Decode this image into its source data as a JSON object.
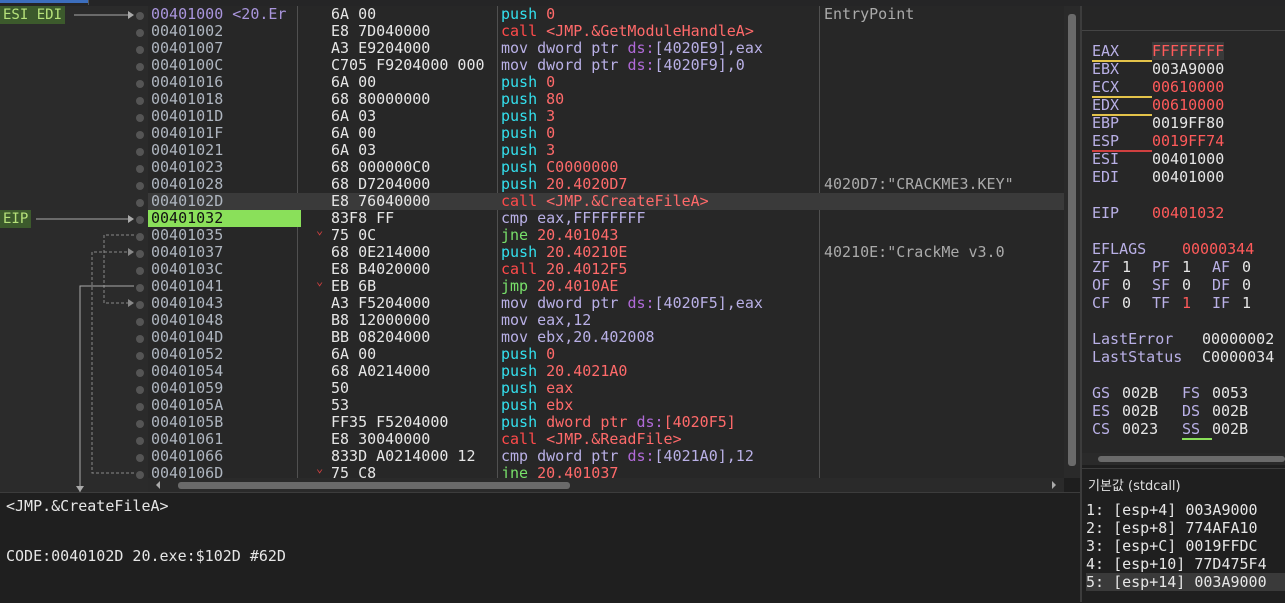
{
  "gutter": {
    "labels": [
      {
        "text": "ESI EDI",
        "row": 0
      },
      {
        "text": "EIP",
        "row": 12
      }
    ]
  },
  "disasm": {
    "rows": [
      {
        "addr": "00401000 <20.Er",
        "bytes": "6A 00",
        "mn": "push",
        "op": "0",
        "cmt": "EntryPoint",
        "style": "push",
        "ep": true
      },
      {
        "addr": "00401002",
        "bytes": "E8 7D040000",
        "mn": "call",
        "op": "<JMP.&GetModuleHandleA>",
        "cmt": "",
        "style": "call"
      },
      {
        "addr": "00401007",
        "bytes": "A3 E9204000",
        "mn": "mov",
        "op": "dword ptr ds:[4020E9],eax",
        "cmt": "",
        "style": "mov"
      },
      {
        "addr": "0040100C",
        "bytes": "C705 F9204000 000",
        "mn": "mov",
        "op": "dword ptr ds:[4020F9],0",
        "cmt": "",
        "style": "mov"
      },
      {
        "addr": "00401016",
        "bytes": "6A 00",
        "mn": "push",
        "op": "0",
        "cmt": "",
        "style": "push"
      },
      {
        "addr": "00401018",
        "bytes": "68 80000000",
        "mn": "push",
        "op": "80",
        "cmt": "",
        "style": "push"
      },
      {
        "addr": "0040101D",
        "bytes": "6A 03",
        "mn": "push",
        "op": "3",
        "cmt": "",
        "style": "push"
      },
      {
        "addr": "0040101F",
        "bytes": "6A 00",
        "mn": "push",
        "op": "0",
        "cmt": "",
        "style": "push"
      },
      {
        "addr": "00401021",
        "bytes": "6A 03",
        "mn": "push",
        "op": "3",
        "cmt": "",
        "style": "push"
      },
      {
        "addr": "00401023",
        "bytes": "68 000000C0",
        "mn": "push",
        "op": "C0000000",
        "cmt": "",
        "style": "push"
      },
      {
        "addr": "00401028",
        "bytes": "68 D7204000",
        "mn": "push",
        "op": "20.4020D7",
        "cmt": "4020D7:\"CRACKME3.KEY\"",
        "style": "push"
      },
      {
        "addr": "0040102D",
        "bytes": "E8 76040000",
        "mn": "call",
        "op": "<JMP.&CreateFileA>",
        "cmt": "",
        "style": "call",
        "sel": true
      },
      {
        "addr": "00401032",
        "bytes": "83F8 FF",
        "mn": "cmp",
        "op": "eax,FFFFFFFF",
        "cmt": "",
        "style": "cmp",
        "eip": true
      },
      {
        "addr": "00401035",
        "bytes": "75 0C",
        "mn": "jne",
        "op": "20.401043",
        "cmt": "",
        "style": "jne"
      },
      {
        "addr": "00401037",
        "bytes": "68 0E214000",
        "mn": "push",
        "op": "20.40210E",
        "cmt": "40210E:\"CrackMe v3.0",
        "style": "push"
      },
      {
        "addr": "0040103C",
        "bytes": "E8 B4020000",
        "mn": "call",
        "op": "20.4012F5",
        "cmt": "",
        "style": "call"
      },
      {
        "addr": "00401041",
        "bytes": "EB 6B",
        "mn": "jmp",
        "op": "20.4010AE",
        "cmt": "",
        "style": "jmp"
      },
      {
        "addr": "00401043",
        "bytes": "A3 F5204000",
        "mn": "mov",
        "op": "dword ptr ds:[4020F5],eax",
        "cmt": "",
        "style": "mov"
      },
      {
        "addr": "00401048",
        "bytes": "B8 12000000",
        "mn": "mov",
        "op": "eax,12",
        "cmt": "",
        "style": "mov"
      },
      {
        "addr": "0040104D",
        "bytes": "BB 08204000",
        "mn": "mov",
        "op": "ebx,20.402008",
        "cmt": "",
        "style": "mov"
      },
      {
        "addr": "00401052",
        "bytes": "6A 00",
        "mn": "push",
        "op": "0",
        "cmt": "",
        "style": "push"
      },
      {
        "addr": "00401054",
        "bytes": "68 A0214000",
        "mn": "push",
        "op": "20.4021A0",
        "cmt": "",
        "style": "push"
      },
      {
        "addr": "00401059",
        "bytes": "50",
        "mn": "push",
        "op": "eax",
        "cmt": "",
        "style": "push"
      },
      {
        "addr": "0040105A",
        "bytes": "53",
        "mn": "push",
        "op": "ebx",
        "cmt": "",
        "style": "push"
      },
      {
        "addr": "0040105B",
        "bytes": "FF35 F5204000",
        "mn": "push",
        "op": "dword ptr ds:[4020F5]",
        "cmt": "",
        "style": "push"
      },
      {
        "addr": "00401061",
        "bytes": "E8 30040000",
        "mn": "call",
        "op": "<JMP.&ReadFile>",
        "cmt": "",
        "style": "call"
      },
      {
        "addr": "00401066",
        "bytes": "833D A0214000 12",
        "mn": "cmp",
        "op": "dword ptr ds:[4021A0],12",
        "cmt": "",
        "style": "cmp"
      },
      {
        "addr": "0040106D",
        "bytes": "75 C8",
        "mn": "jne",
        "op": "20.401037",
        "cmt": "",
        "style": "jne"
      }
    ]
  },
  "registers": [
    {
      "name": "EAX",
      "value": "FFFFFFFF",
      "red": true,
      "ul": "#e4c34a",
      "hl": true
    },
    {
      "name": "EBX",
      "value": "003A9000",
      "red": false
    },
    {
      "name": "ECX",
      "value": "00610000",
      "red": true,
      "ul": "#e4c34a"
    },
    {
      "name": "EDX",
      "value": "00610000",
      "red": true,
      "ul": "#e4c34a"
    },
    {
      "name": "EBP",
      "value": "0019FF80",
      "red": false
    },
    {
      "name": "ESP",
      "value": "0019FF74",
      "red": true,
      "ul": "#d04040"
    },
    {
      "name": "ESI",
      "value": "00401000",
      "red": false
    },
    {
      "name": "EDI",
      "value": "00401000",
      "red": false
    },
    {
      "name": "EIP",
      "value": "00401032",
      "red": true
    },
    {
      "name": "EFLAGS",
      "value": "00000344",
      "red": true
    }
  ],
  "flags": [
    [
      {
        "n": "ZF",
        "v": "1",
        "red": false
      },
      {
        "n": "PF",
        "v": "1",
        "red": false
      },
      {
        "n": "AF",
        "v": "0",
        "red": false
      }
    ],
    [
      {
        "n": "OF",
        "v": "0",
        "red": false
      },
      {
        "n": "SF",
        "v": "0",
        "red": false
      },
      {
        "n": "DF",
        "v": "0",
        "red": false
      }
    ],
    [
      {
        "n": "CF",
        "v": "0",
        "red": false
      },
      {
        "n": "TF",
        "v": "1",
        "red": true
      },
      {
        "n": "IF",
        "v": "1",
        "red": false
      }
    ]
  ],
  "last": [
    {
      "name": "LastError",
      "value": "00000002"
    },
    {
      "name": "LastStatus",
      "value": "C0000034"
    }
  ],
  "segs": [
    [
      {
        "n": "GS",
        "v": "002B"
      },
      {
        "n": "FS",
        "v": "0053"
      }
    ],
    [
      {
        "n": "ES",
        "v": "002B"
      },
      {
        "n": "DS",
        "v": "002B"
      }
    ],
    [
      {
        "n": "CS",
        "v": "0023"
      },
      {
        "n": "SS",
        "v": "002B",
        "ul": "#8ae05a"
      }
    ]
  ],
  "info": {
    "line1": "<JMP.&CreateFileA>",
    "line2": "CODE:0040102D 20.exe:$102D #62D"
  },
  "args": {
    "header": "기본값 (stdcall)",
    "items": [
      "1: [esp+4] 003A9000",
      "2: [esp+8] 774AFA10",
      "3: [esp+C] 0019FFDC",
      "4: [esp+10] 77D475F4",
      "5: [esp+14] 003A9000"
    ]
  }
}
